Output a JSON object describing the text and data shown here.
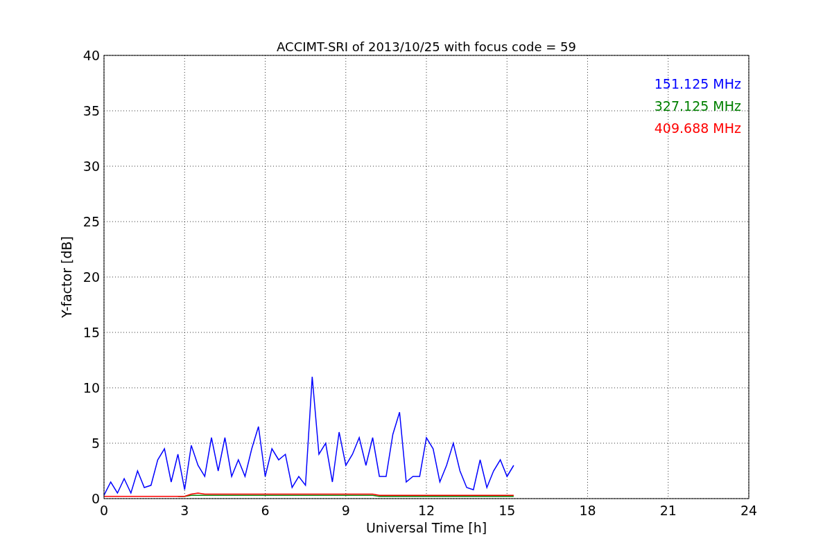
{
  "figure": {
    "chart_data": {
      "type": "line",
      "title": "ACCIMT-SRI of 2013/10/25 with focus code = 59",
      "xlabel": "Universal Time [h]",
      "ylabel": "Y-factor [dB]",
      "x": [
        0,
        0.25,
        0.5,
        0.75,
        1,
        1.25,
        1.5,
        1.75,
        2,
        2.25,
        2.5,
        2.75,
        3,
        3.25,
        3.5,
        3.75,
        4,
        4.25,
        4.5,
        4.75,
        5,
        5.25,
        5.5,
        5.75,
        6,
        6.25,
        6.5,
        6.75,
        7,
        7.25,
        7.5,
        7.75,
        8,
        8.25,
        8.5,
        8.75,
        9,
        9.25,
        9.5,
        9.75,
        10,
        10.25,
        10.5,
        10.75,
        11,
        11.25,
        11.5,
        11.75,
        12,
        12.25,
        12.5,
        12.75,
        13,
        13.25,
        13.5,
        13.75,
        14,
        14.25,
        14.5,
        14.75,
        15,
        15.25
      ],
      "series": [
        {
          "name": "151.125 MHz",
          "color": "#0000ff",
          "values": [
            0.3,
            1.5,
            0.5,
            1.8,
            0.5,
            2.5,
            1,
            1.2,
            3.5,
            4.5,
            1.5,
            4,
            0.8,
            4.8,
            3,
            2,
            5.5,
            2.5,
            5.5,
            2,
            3.5,
            2,
            4.5,
            6.5,
            2,
            4.5,
            3.5,
            4,
            1,
            2,
            1.2,
            11,
            4,
            5,
            1.5,
            6,
            3,
            4,
            5.5,
            3,
            5.5,
            2,
            2,
            5.8,
            7.8,
            1.5,
            2,
            2,
            5.5,
            4.5,
            1.5,
            3,
            5,
            2.5,
            1,
            0.8,
            3.5,
            1,
            2.5,
            3.5,
            2,
            3
          ]
        },
        {
          "name": "327.125 MHz",
          "color": "#008000",
          "values": [
            null,
            null,
            null,
            null,
            null,
            null,
            null,
            null,
            null,
            null,
            null,
            0.2,
            0.2,
            0.3,
            0.3,
            0.3,
            0.3,
            0.3,
            0.3,
            0.3,
            0.3,
            0.3,
            0.3,
            0.3,
            0.3,
            0.3,
            0.3,
            0.3,
            0.3,
            0.3,
            0.3,
            0.3,
            0.3,
            0.3,
            0.3,
            0.3,
            0.3,
            0.3,
            0.3,
            0.3,
            0.3,
            0.2,
            0.2,
            0.2,
            0.2,
            0.2,
            0.2,
            0.2,
            0.2,
            0.2,
            0.2,
            0.2,
            0.2,
            0.2,
            0.2,
            0.2,
            0.2,
            0.2,
            0.2,
            0.2,
            0.2,
            0.2
          ]
        },
        {
          "name": "409.688 MHz",
          "color": "#ff0000",
          "values": [
            0.2,
            0.2,
            0.2,
            0.2,
            0.2,
            0.2,
            0.2,
            0.2,
            0.2,
            0.2,
            0.2,
            0.2,
            0.2,
            0.4,
            0.5,
            0.4,
            0.4,
            0.4,
            0.4,
            0.4,
            0.4,
            0.4,
            0.4,
            0.4,
            0.4,
            0.4,
            0.4,
            0.4,
            0.4,
            0.4,
            0.4,
            0.4,
            0.4,
            0.4,
            0.4,
            0.4,
            0.4,
            0.4,
            0.4,
            0.4,
            0.4,
            0.3,
            0.3,
            0.3,
            0.3,
            0.3,
            0.3,
            0.3,
            0.3,
            0.3,
            0.3,
            0.3,
            0.3,
            0.3,
            0.3,
            0.3,
            0.3,
            0.3,
            0.3,
            0.3,
            0.3,
            0.3
          ]
        }
      ],
      "grid": true,
      "xlim": [
        0,
        24
      ],
      "ylim": [
        0,
        40
      ],
      "xticks": [
        0,
        3,
        6,
        9,
        12,
        15,
        18,
        21,
        24
      ],
      "yticks": [
        0,
        5,
        10,
        15,
        20,
        25,
        30,
        35,
        40
      ]
    }
  }
}
